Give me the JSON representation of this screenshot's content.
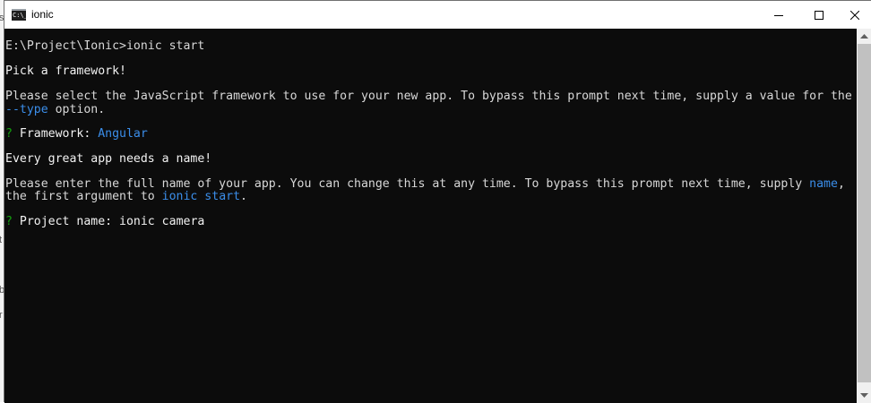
{
  "window": {
    "title": "ionic",
    "app_icon_text": "C:\\_"
  },
  "terminal": {
    "lines": [
      {
        "segments": [
          {
            "text": "E:\\Project\\Ionic>ionic start",
            "color": "default"
          }
        ]
      },
      {
        "segments": [
          {
            "text": "Pick a framework!",
            "color": "white"
          }
        ]
      },
      {
        "segments": [
          {
            "text": "Please select the JavaScript framework to use for your new app. To bypass this prompt next time, supply a value for the",
            "color": "default"
          }
        ]
      },
      {
        "segments": [
          {
            "text": "--type",
            "color": "cyan"
          },
          {
            "text": " option.",
            "color": "default"
          }
        ]
      },
      {
        "segments": [
          {
            "text": "?",
            "color": "green"
          },
          {
            "text": " Framework: ",
            "color": "white"
          },
          {
            "text": "Angular",
            "color": "cyan"
          }
        ]
      },
      {
        "segments": [
          {
            "text": "Every great app needs a name!",
            "color": "white"
          }
        ]
      },
      {
        "segments": [
          {
            "text": "Please enter the full name of your app. You can change this at any time. To bypass this prompt next time, supply ",
            "color": "default"
          },
          {
            "text": "name",
            "color": "cyan"
          },
          {
            "text": ",",
            "color": "default"
          }
        ]
      },
      {
        "segments": [
          {
            "text": "the first argument to ",
            "color": "default"
          },
          {
            "text": "ionic start",
            "color": "cyan"
          },
          {
            "text": ".",
            "color": "default"
          }
        ]
      },
      {
        "segments": [
          {
            "text": "?",
            "color": "green"
          },
          {
            "text": " Project name: ",
            "color": "white"
          },
          {
            "text": "ionic camera",
            "color": "white"
          }
        ]
      }
    ]
  },
  "background_fragments": [
    "s",
    "t",
    "b",
    "r"
  ],
  "colors": {
    "console_bg": "#0c0c0c",
    "text_default": "#d8d8d8",
    "text_white": "#f2f2f2",
    "accent_cyan": "#3b8eea",
    "prompt_green": "#13a10e"
  }
}
